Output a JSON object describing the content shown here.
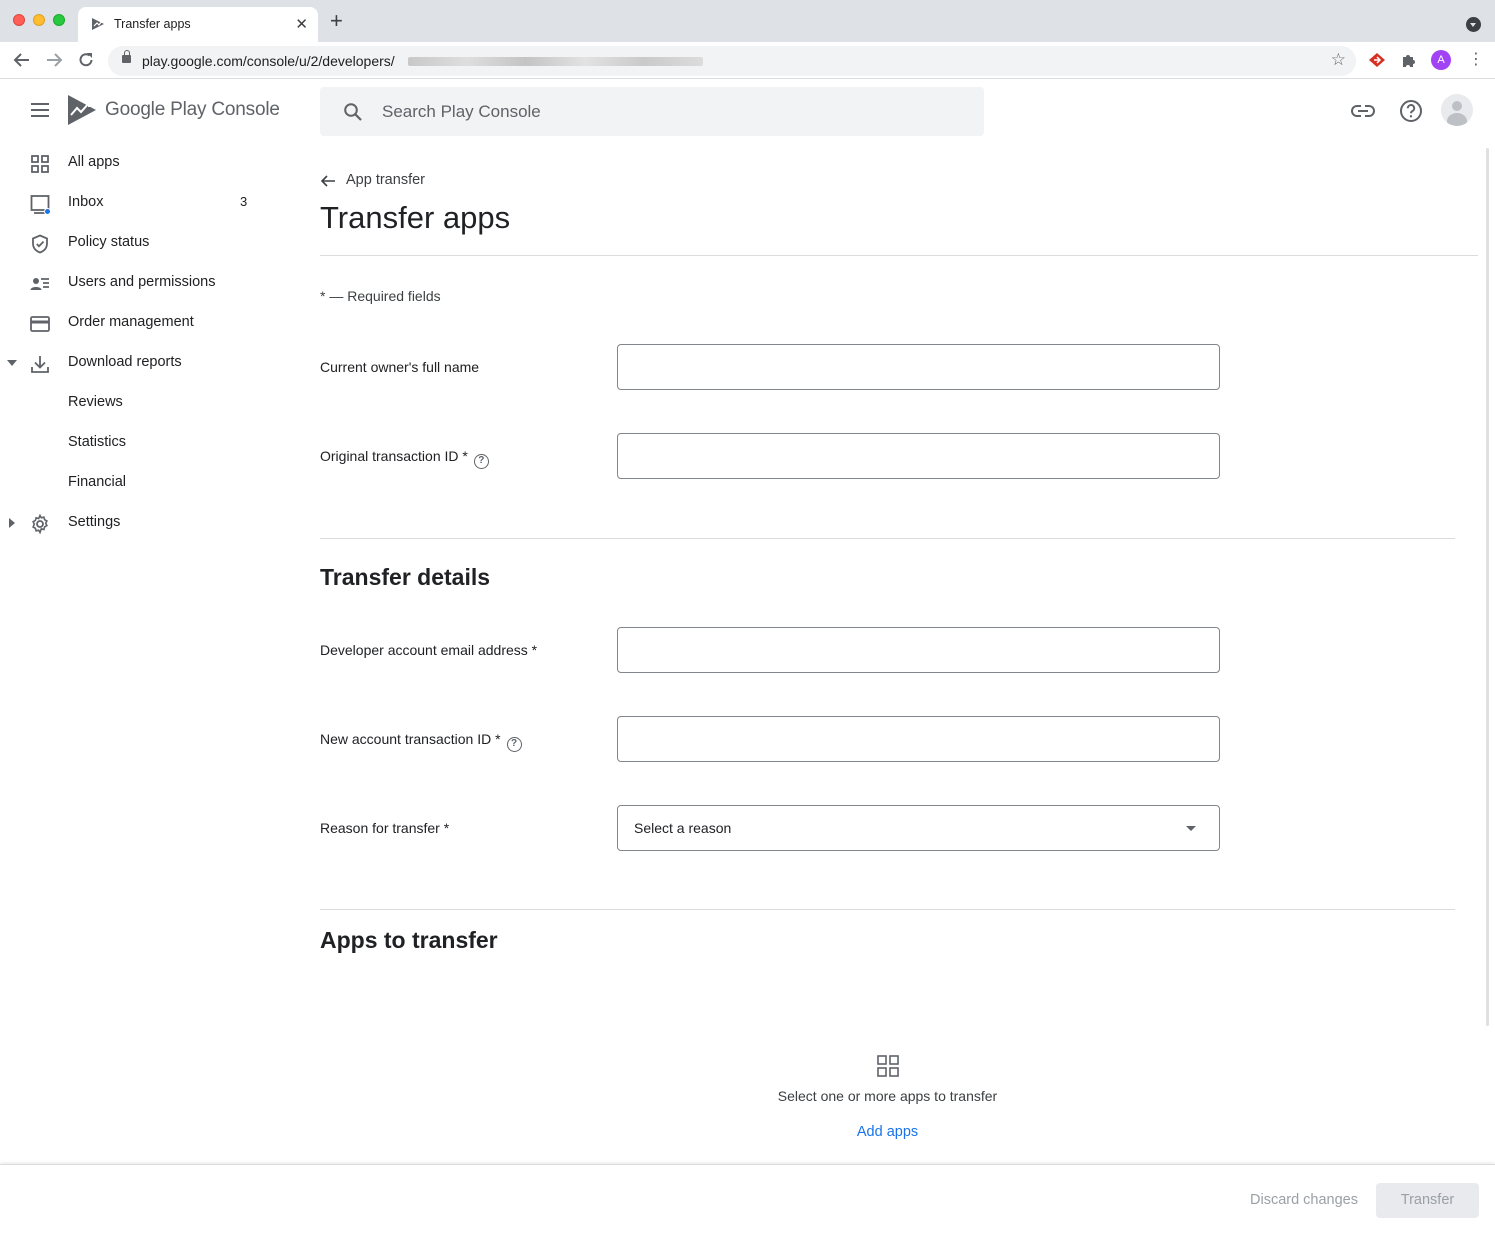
{
  "browser": {
    "tab_title": "Transfer apps",
    "url": "play.google.com/console/u/2/developers/",
    "profile_initial": "A"
  },
  "header": {
    "logo_google_play": "Google Play",
    "logo_console": "Console",
    "search_placeholder": "Search Play Console"
  },
  "sidebar": {
    "items": [
      {
        "label": "All apps",
        "icon": "grid-icon"
      },
      {
        "label": "Inbox",
        "icon": "inbox-icon",
        "count": "3"
      },
      {
        "label": "Policy status",
        "icon": "shield-icon"
      },
      {
        "label": "Users and permissions",
        "icon": "users-icon"
      },
      {
        "label": "Order management",
        "icon": "credit-card-icon"
      },
      {
        "label": "Download reports",
        "icon": "download-icon",
        "expanded": true
      },
      {
        "label": "Reviews"
      },
      {
        "label": "Statistics"
      },
      {
        "label": "Financial"
      },
      {
        "label": "Settings",
        "icon": "gear-icon",
        "expanded": false
      }
    ]
  },
  "main": {
    "back_link": "App transfer",
    "title": "Transfer apps",
    "required_note": "* — Required fields",
    "fields": {
      "owner_name": {
        "label": "Current owner's full name",
        "value": ""
      },
      "original_txn": {
        "label": "Original transaction ID *",
        "value": ""
      },
      "dev_email": {
        "label": "Developer account email address *",
        "value": ""
      },
      "new_txn": {
        "label": "New account transaction ID *",
        "value": ""
      },
      "reason": {
        "label": "Reason for transfer *",
        "value": "Select a reason"
      }
    },
    "section_transfer_details": "Transfer details",
    "section_apps": "Apps to transfer",
    "empty_state_text": "Select one or more apps to transfer",
    "add_apps_label": "Add apps"
  },
  "footer": {
    "discard_label": "Discard changes",
    "transfer_label": "Transfer"
  },
  "colors": {
    "accent": "#1a73e8",
    "inbox_dot": "#1a73e8",
    "disabled_text": "#9aa0a6"
  }
}
